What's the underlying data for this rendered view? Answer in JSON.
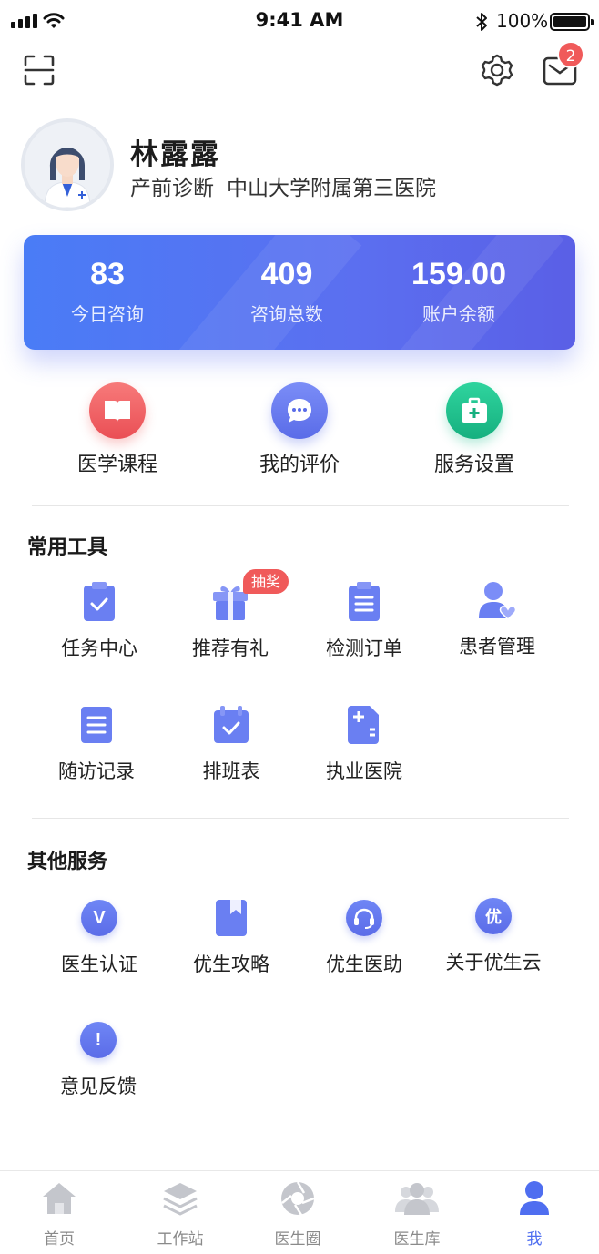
{
  "status_bar": {
    "time": "9:41 AM",
    "battery": "100%"
  },
  "header": {
    "message_count": "2",
    "icons": [
      "scan-icon",
      "gear-icon",
      "message-icon"
    ]
  },
  "profile": {
    "name": "林露露",
    "department": "产前诊断",
    "hospital": "中山大学附属第三医院"
  },
  "stats": [
    {
      "value": "83",
      "label": "今日咨询"
    },
    {
      "value": "409",
      "label": "咨询总数"
    },
    {
      "value": "159.00",
      "label": "账户余额"
    }
  ],
  "quick_actions": [
    {
      "label": "医学课程",
      "icon": "book-icon",
      "color": "#f05a5a"
    },
    {
      "label": "我的评价",
      "icon": "comment-icon",
      "color": "#5b6ff0"
    },
    {
      "label": "服务设置",
      "icon": "medkit-icon",
      "color": "#22c08f"
    }
  ],
  "tools": {
    "title": "常用工具",
    "lottery_tag": "抽奖",
    "items": [
      {
        "label": "任务中心",
        "icon": "clipboard-check-icon"
      },
      {
        "label": "推荐有礼",
        "icon": "gift-icon"
      },
      {
        "label": "检测订单",
        "icon": "clipboard-list-icon"
      },
      {
        "label": "患者管理",
        "icon": "patient-icon"
      },
      {
        "label": "随访记录",
        "icon": "document-icon"
      },
      {
        "label": "排班表",
        "icon": "calendar-check-icon"
      },
      {
        "label": "执业医院",
        "icon": "hospital-icon"
      }
    ]
  },
  "services": {
    "title": "其他服务",
    "items": [
      {
        "label": "医生认证",
        "icon": "verify-icon",
        "glyph": "V"
      },
      {
        "label": "优生攻略",
        "icon": "bookmark-icon",
        "glyph": ""
      },
      {
        "label": "优生医助",
        "icon": "headset-icon",
        "glyph": ""
      },
      {
        "label": "关于优生云",
        "icon": "about-icon",
        "glyph": "优"
      },
      {
        "label": "意见反馈",
        "icon": "feedback-icon",
        "glyph": "!"
      }
    ]
  },
  "tabbar": {
    "active": "我",
    "accent": "#4f6ef0",
    "items": [
      {
        "label": "首页",
        "icon": "home-icon"
      },
      {
        "label": "工作站",
        "icon": "layers-icon"
      },
      {
        "label": "医生圈",
        "icon": "aperture-icon"
      },
      {
        "label": "医生库",
        "icon": "group-icon"
      },
      {
        "label": "我",
        "icon": "user-icon"
      }
    ]
  }
}
